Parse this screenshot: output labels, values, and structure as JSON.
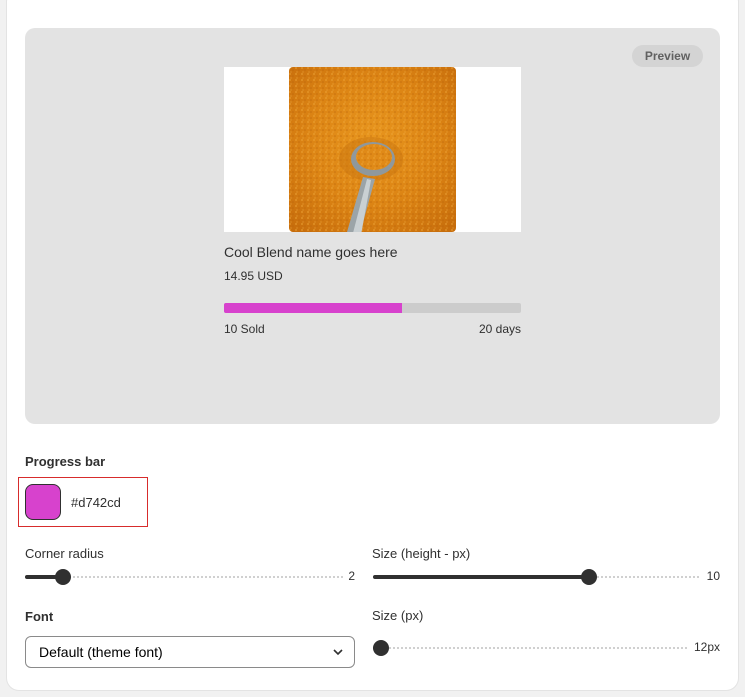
{
  "preview": {
    "badge": "Preview",
    "image_icon": "turmeric-powder-spoon-image",
    "product_name": "Cool Blend name goes here",
    "price": "14.95 USD",
    "progress_fraction": 0.6,
    "progress_color": "#d742cd",
    "sold": "10 Sold",
    "days": "20 days"
  },
  "progress_bar": {
    "title": "Progress bar",
    "color_value": "#d742cd"
  },
  "corner_radius": {
    "label": "Corner radius",
    "value": 2,
    "value_text": "2",
    "min": 0,
    "max": 20
  },
  "bar_height": {
    "label": "Size (height - px)",
    "value": 10,
    "value_text": "10",
    "min": 0,
    "max": 15
  },
  "font": {
    "label": "Font",
    "selected": "Default (theme font)"
  },
  "font_size": {
    "label": "Size (px)",
    "value": 0,
    "value_text": "12px",
    "min": 0,
    "max": 100
  },
  "colors": {
    "accent": "#d742cd",
    "track": "#cccccc",
    "preview_bg": "#e3e3e3"
  }
}
